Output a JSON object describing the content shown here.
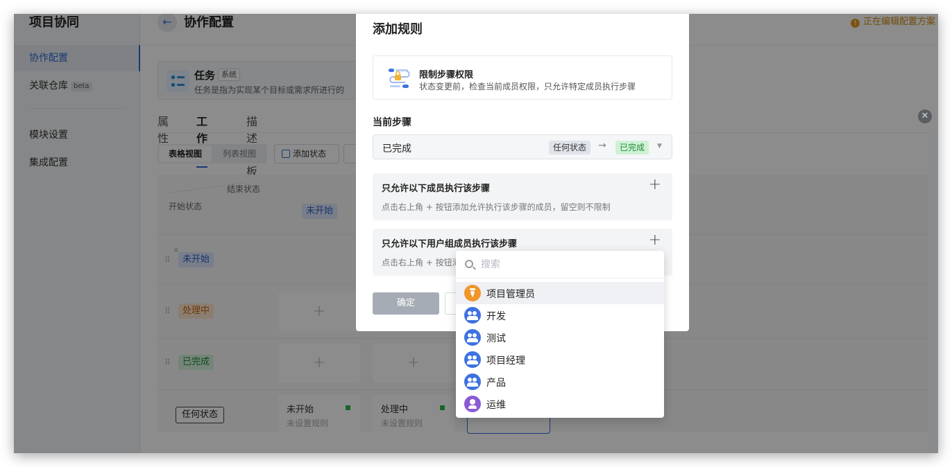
{
  "sidebar": {
    "title": "项目协同",
    "items": [
      {
        "label": "协作配置"
      },
      {
        "label": "关联仓库",
        "badge": "beta"
      },
      {
        "label": "模块设置"
      },
      {
        "label": "集成配置"
      }
    ]
  },
  "header": {
    "title": "协作配置",
    "editing_status": "正在编辑配置方案"
  },
  "task": {
    "name": "任务",
    "tag": "系统",
    "desc": "任务是指为实现某个目标或需求所进行的"
  },
  "tabs": [
    "属性",
    "工作流",
    "描述模板"
  ],
  "toolbar": {
    "view_table": "表格视图",
    "view_list": "列表视图",
    "add_state": "添加状态"
  },
  "matrix": {
    "corner_end": "结束状态",
    "corner_start": "开始状态",
    "column_states": [
      "未开始"
    ],
    "row_states": [
      "未开始",
      "处理中",
      "已完成"
    ],
    "any_state": "任何状态",
    "any_row_cells": [
      {
        "title": "未开始",
        "sub": "未设置规则"
      },
      {
        "title": "处理中",
        "sub": "未设置规则"
      }
    ]
  },
  "modal": {
    "title": "添加规则",
    "rule": {
      "title": "限制步骤权限",
      "desc": "状态变更前，检查当前成员权限，只允许特定成员执行步骤"
    },
    "current_step_label": "当前步骤",
    "current_step": {
      "value": "已完成",
      "from": "任何状态",
      "arrow": "→",
      "to": "已完成"
    },
    "members_section": {
      "title": "只允许以下成员执行该步骤",
      "sub": "点击右上角 + 按钮添加允许执行该步骤的成员，留空则不限制"
    },
    "groups_section": {
      "title": "只允许以下用户组成员执行该步骤",
      "sub": "点击右上角 + 按钮添"
    },
    "ok_label": "确定"
  },
  "dropdown": {
    "search_placeholder": "搜索",
    "items": [
      {
        "label": "项目管理员",
        "icon": "admin-icon",
        "color": "#f0962a"
      },
      {
        "label": "开发",
        "icon": "group-icon",
        "color": "#3d72e0"
      },
      {
        "label": "测试",
        "icon": "group-icon",
        "color": "#3d72e0"
      },
      {
        "label": "项目经理",
        "icon": "group-icon",
        "color": "#3d72e0"
      },
      {
        "label": "产品",
        "icon": "group-icon",
        "color": "#3d72e0"
      },
      {
        "label": "运维",
        "icon": "user-icon",
        "color": "#8b5ad6"
      }
    ]
  }
}
